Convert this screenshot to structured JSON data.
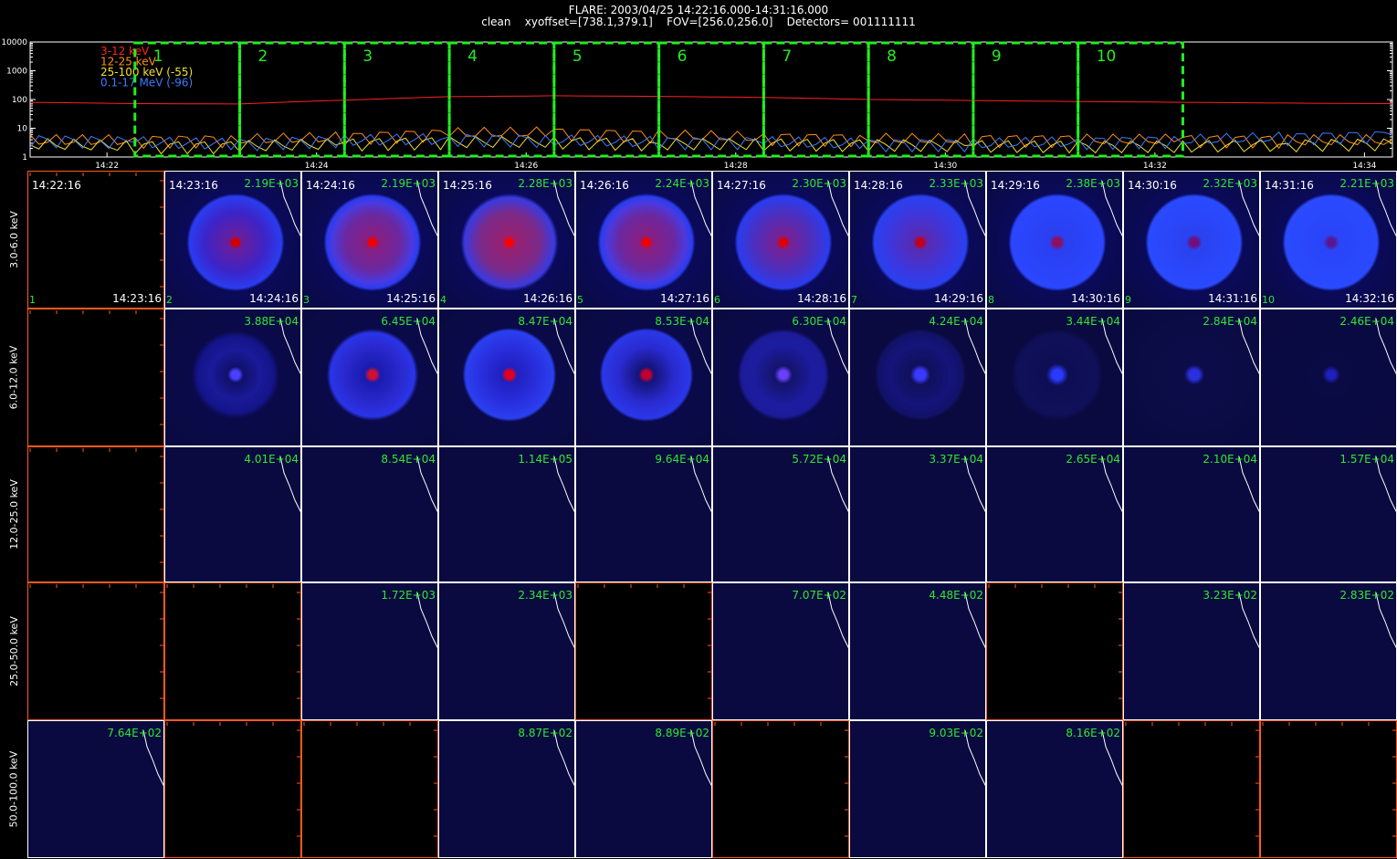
{
  "header": {
    "line1": "FLARE: 2003/04/25 14:22:16.000-14:31:16.000",
    "line2": "clean    xyoffset=[738.1,379.1]    FOV=[256.0,256.0]    Detectors= 001111111"
  },
  "chart_data": [
    {
      "type": "line",
      "yscale": "log",
      "ylim": [
        1,
        10000
      ],
      "xlim": [
        "14:21:16",
        "14:34:16"
      ],
      "ytick_labels": [
        "1",
        "10",
        "100",
        "1000",
        "10000"
      ],
      "xtick_labels": [
        "14:22",
        "14:24",
        "14:26",
        "14:28",
        "14:30",
        "14:32",
        "14:34"
      ],
      "legend": [
        {
          "label": "3-12 keV",
          "color": "#ff2020"
        },
        {
          "label": "12-25 keV",
          "color": "#ff8c1a"
        },
        {
          "label": "25-100 keV (-55)",
          "color": "#f2e030"
        },
        {
          "label": "0.1-17 MeV (-96)",
          "color": "#3d7bff"
        }
      ],
      "series": [
        {
          "name": "3-12 keV",
          "color": "#ff2020",
          "x": [
            "14:21:16",
            "14:22:16",
            "14:23:16",
            "14:24:16",
            "14:25:16",
            "14:26:16",
            "14:27:16",
            "14:28:16",
            "14:29:16",
            "14:30:16",
            "14:31:16",
            "14:32:16",
            "14:33:16",
            "14:34:16"
          ],
          "values": [
            80,
            72,
            70,
            95,
            125,
            135,
            128,
            118,
            100,
            92,
            85,
            80,
            75,
            72
          ]
        },
        {
          "name": "12-25 keV",
          "color": "#ff8c1a",
          "x": [
            "14:21:16",
            "14:22:16",
            "14:23:16",
            "14:24:16",
            "14:25:16",
            "14:26:16",
            "14:27:16",
            "14:28:16",
            "14:29:16",
            "14:30:16",
            "14:31:16",
            "14:32:16",
            "14:33:16",
            "14:34:16"
          ],
          "values": [
            4,
            4,
            4.2,
            5,
            7,
            7.5,
            6,
            5,
            4.5,
            4.3,
            4.2,
            4.2,
            4,
            4
          ]
        },
        {
          "name": "25-100 keV (-55)",
          "color": "#f2e030",
          "x": [
            "14:21:16",
            "14:22:16",
            "14:23:16",
            "14:24:16",
            "14:25:16",
            "14:26:16",
            "14:27:16",
            "14:28:16",
            "14:29:16",
            "14:30:16",
            "14:31:16",
            "14:32:16",
            "14:33:16",
            "14:34:16"
          ],
          "values": [
            3,
            2.5,
            2.5,
            3,
            3.5,
            3.5,
            3,
            3,
            2.8,
            2.6,
            2.5,
            2.5,
            2.8,
            3
          ]
        },
        {
          "name": "0.1-17 MeV (-96)",
          "color": "#3d7bff",
          "x": [
            "14:21:16",
            "14:22:16",
            "14:23:16",
            "14:24:16",
            "14:25:16",
            "14:26:16",
            "14:27:16",
            "14:28:16",
            "14:29:16",
            "14:30:16",
            "14:31:16",
            "14:32:16",
            "14:33:16",
            "14:34:16"
          ],
          "values": [
            4,
            3.5,
            3,
            4,
            4.5,
            4,
            3.5,
            3.5,
            3,
            3,
            3.5,
            4,
            5,
            6
          ]
        }
      ],
      "intervals": [
        {
          "label": "1",
          "start": "14:22:16",
          "end": "14:23:16"
        },
        {
          "label": "2",
          "start": "14:23:16",
          "end": "14:24:16"
        },
        {
          "label": "3",
          "start": "14:24:16",
          "end": "14:25:16"
        },
        {
          "label": "4",
          "start": "14:25:16",
          "end": "14:26:16"
        },
        {
          "label": "5",
          "start": "14:26:16",
          "end": "14:27:16"
        },
        {
          "label": "6",
          "start": "14:27:16",
          "end": "14:28:16"
        },
        {
          "label": "7",
          "start": "14:28:16",
          "end": "14:29:16"
        },
        {
          "label": "8",
          "start": "14:29:16",
          "end": "14:30:16"
        },
        {
          "label": "9",
          "start": "14:30:16",
          "end": "14:31:16"
        },
        {
          "label": "10",
          "start": "14:31:16",
          "end": "14:32:16"
        }
      ]
    },
    {
      "type": "heatmap",
      "energy_bands": [
        "3.0-6.0 keV",
        "6.0-12.0 keV",
        "12.0-25.0 keV",
        "25.0-50.0 keV",
        "50.0-100.0 keV"
      ],
      "time_bins": [
        {
          "start": "14:22:16",
          "end": "14:23:16",
          "index": "1"
        },
        {
          "start": "14:23:16",
          "end": "14:24:16",
          "index": "2"
        },
        {
          "start": "14:24:16",
          "end": "14:25:16",
          "index": "3"
        },
        {
          "start": "14:25:16",
          "end": "14:26:16",
          "index": "4"
        },
        {
          "start": "14:26:16",
          "end": "14:27:16",
          "index": "5"
        },
        {
          "start": "14:27:16",
          "end": "14:28:16",
          "index": "6"
        },
        {
          "start": "14:28:16",
          "end": "14:29:16",
          "index": "7"
        },
        {
          "start": "14:29:16",
          "end": "14:30:16",
          "index": "8"
        },
        {
          "start": "14:30:16",
          "end": "14:31:16",
          "index": "9"
        },
        {
          "start": "14:31:16",
          "end": "14:32:16",
          "index": "10"
        }
      ],
      "peak_values": [
        [
          null,
          "2.19E+03",
          "2.19E+03",
          "2.28E+03",
          "2.24E+03",
          "2.30E+03",
          "2.33E+03",
          "2.38E+03",
          "2.32E+03",
          "2.21E+03"
        ],
        [
          null,
          "3.88E+04",
          "6.45E+04",
          "8.47E+04",
          "8.53E+04",
          "6.30E+04",
          "4.24E+04",
          "3.44E+04",
          "2.84E+04",
          "2.46E+04"
        ],
        [
          null,
          "4.01E+04",
          "8.54E+04",
          "1.14E+05",
          "9.64E+04",
          "5.72E+04",
          "3.37E+04",
          "2.65E+04",
          "2.10E+04",
          "1.57E+04"
        ],
        [
          null,
          null,
          "1.72E+03",
          "2.34E+03",
          null,
          "7.07E+02",
          "4.48E+02",
          null,
          "3.23E+02",
          "2.83E+02"
        ],
        [
          "7.64E+02",
          null,
          null,
          "8.87E+02",
          "8.89E+02",
          null,
          "9.03E+02",
          "8.16E+02",
          null,
          null
        ]
      ]
    }
  ]
}
